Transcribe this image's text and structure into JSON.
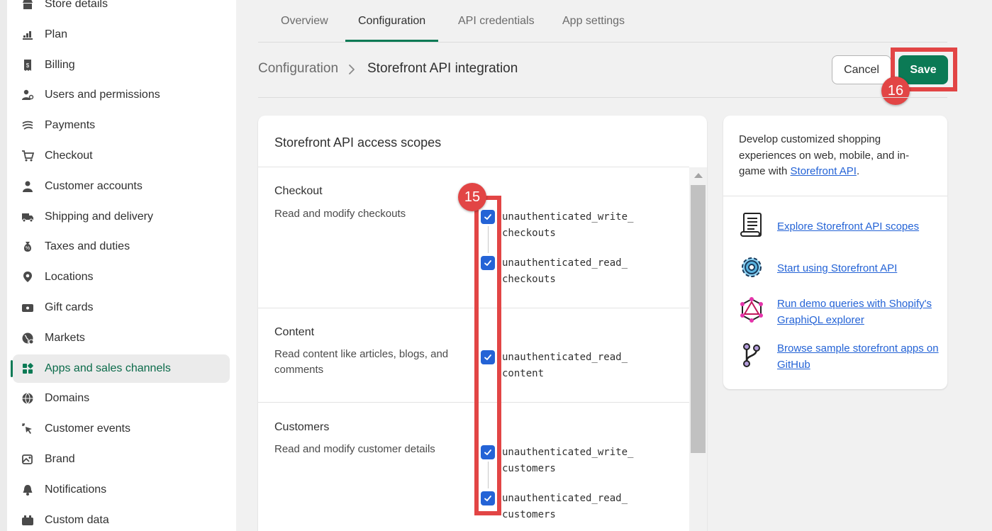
{
  "sidebar": {
    "items": [
      {
        "label": "Store details",
        "icon": "store-icon"
      },
      {
        "label": "Plan",
        "icon": "plan-icon"
      },
      {
        "label": "Billing",
        "icon": "billing-icon"
      },
      {
        "label": "Users and permissions",
        "icon": "users-icon"
      },
      {
        "label": "Payments",
        "icon": "payments-icon"
      },
      {
        "label": "Checkout",
        "icon": "cart-icon"
      },
      {
        "label": "Customer accounts",
        "icon": "person-icon"
      },
      {
        "label": "Shipping and delivery",
        "icon": "truck-icon"
      },
      {
        "label": "Taxes and duties",
        "icon": "taxes-icon"
      },
      {
        "label": "Locations",
        "icon": "location-icon"
      },
      {
        "label": "Gift cards",
        "icon": "gift-card-icon"
      },
      {
        "label": "Markets",
        "icon": "globe-icon"
      },
      {
        "label": "Apps and sales channels",
        "icon": "apps-icon",
        "active": true
      },
      {
        "label": "Domains",
        "icon": "domains-icon"
      },
      {
        "label": "Customer events",
        "icon": "cursor-icon"
      },
      {
        "label": "Brand",
        "icon": "brand-icon"
      },
      {
        "label": "Notifications",
        "icon": "bell-icon"
      },
      {
        "label": "Custom data",
        "icon": "custom-data-icon"
      }
    ]
  },
  "tabs": [
    "Overview",
    "Configuration",
    "API credentials",
    "App settings"
  ],
  "active_tab": "Configuration",
  "breadcrumb": {
    "root": "Configuration",
    "current": "Storefront API integration"
  },
  "actions": {
    "cancel": "Cancel",
    "save": "Save"
  },
  "annotations": {
    "checkboxes_step": "15",
    "save_step": "16"
  },
  "colors": {
    "accent": "#0b7a55",
    "checkbox": "#2463d6",
    "highlight": "#e24545",
    "link": "#2463d6"
  },
  "scopes_card": {
    "title": "Storefront API access scopes",
    "sections": [
      {
        "title": "Checkout",
        "description": "Read and modify checkouts",
        "scopes": [
          {
            "l1": "unauthenticated_write_",
            "l2": "checkouts",
            "checked": true
          },
          {
            "l1": "unauthenticated_read_",
            "l2": "checkouts",
            "checked": true
          }
        ]
      },
      {
        "title": "Content",
        "description": "Read content like articles, blogs, and comments",
        "scopes": [
          {
            "l1": "unauthenticated_read_",
            "l2": "content",
            "checked": true
          }
        ]
      },
      {
        "title": "Customers",
        "description": "Read and modify customer details",
        "scopes": [
          {
            "l1": "unauthenticated_write_",
            "l2": "customers",
            "checked": true
          },
          {
            "l1": "unauthenticated_read_",
            "l2": "customers",
            "checked": true
          }
        ]
      }
    ]
  },
  "info_card": {
    "intro": "Develop customized shopping experiences on web, mobile, and in-game with ",
    "intro_link": "Storefront API",
    "intro_end": ".",
    "links": [
      {
        "label": "Explore Storefront API scopes",
        "icon": "scroll-icon"
      },
      {
        "label": "Start using Storefront API",
        "icon": "gear-icon"
      },
      {
        "label": "Run demo queries with Shopify's GraphiQL explorer",
        "icon": "graphql-icon"
      },
      {
        "label": "Browse sample storefront apps on GitHub",
        "icon": "git-branch-icon"
      }
    ]
  }
}
